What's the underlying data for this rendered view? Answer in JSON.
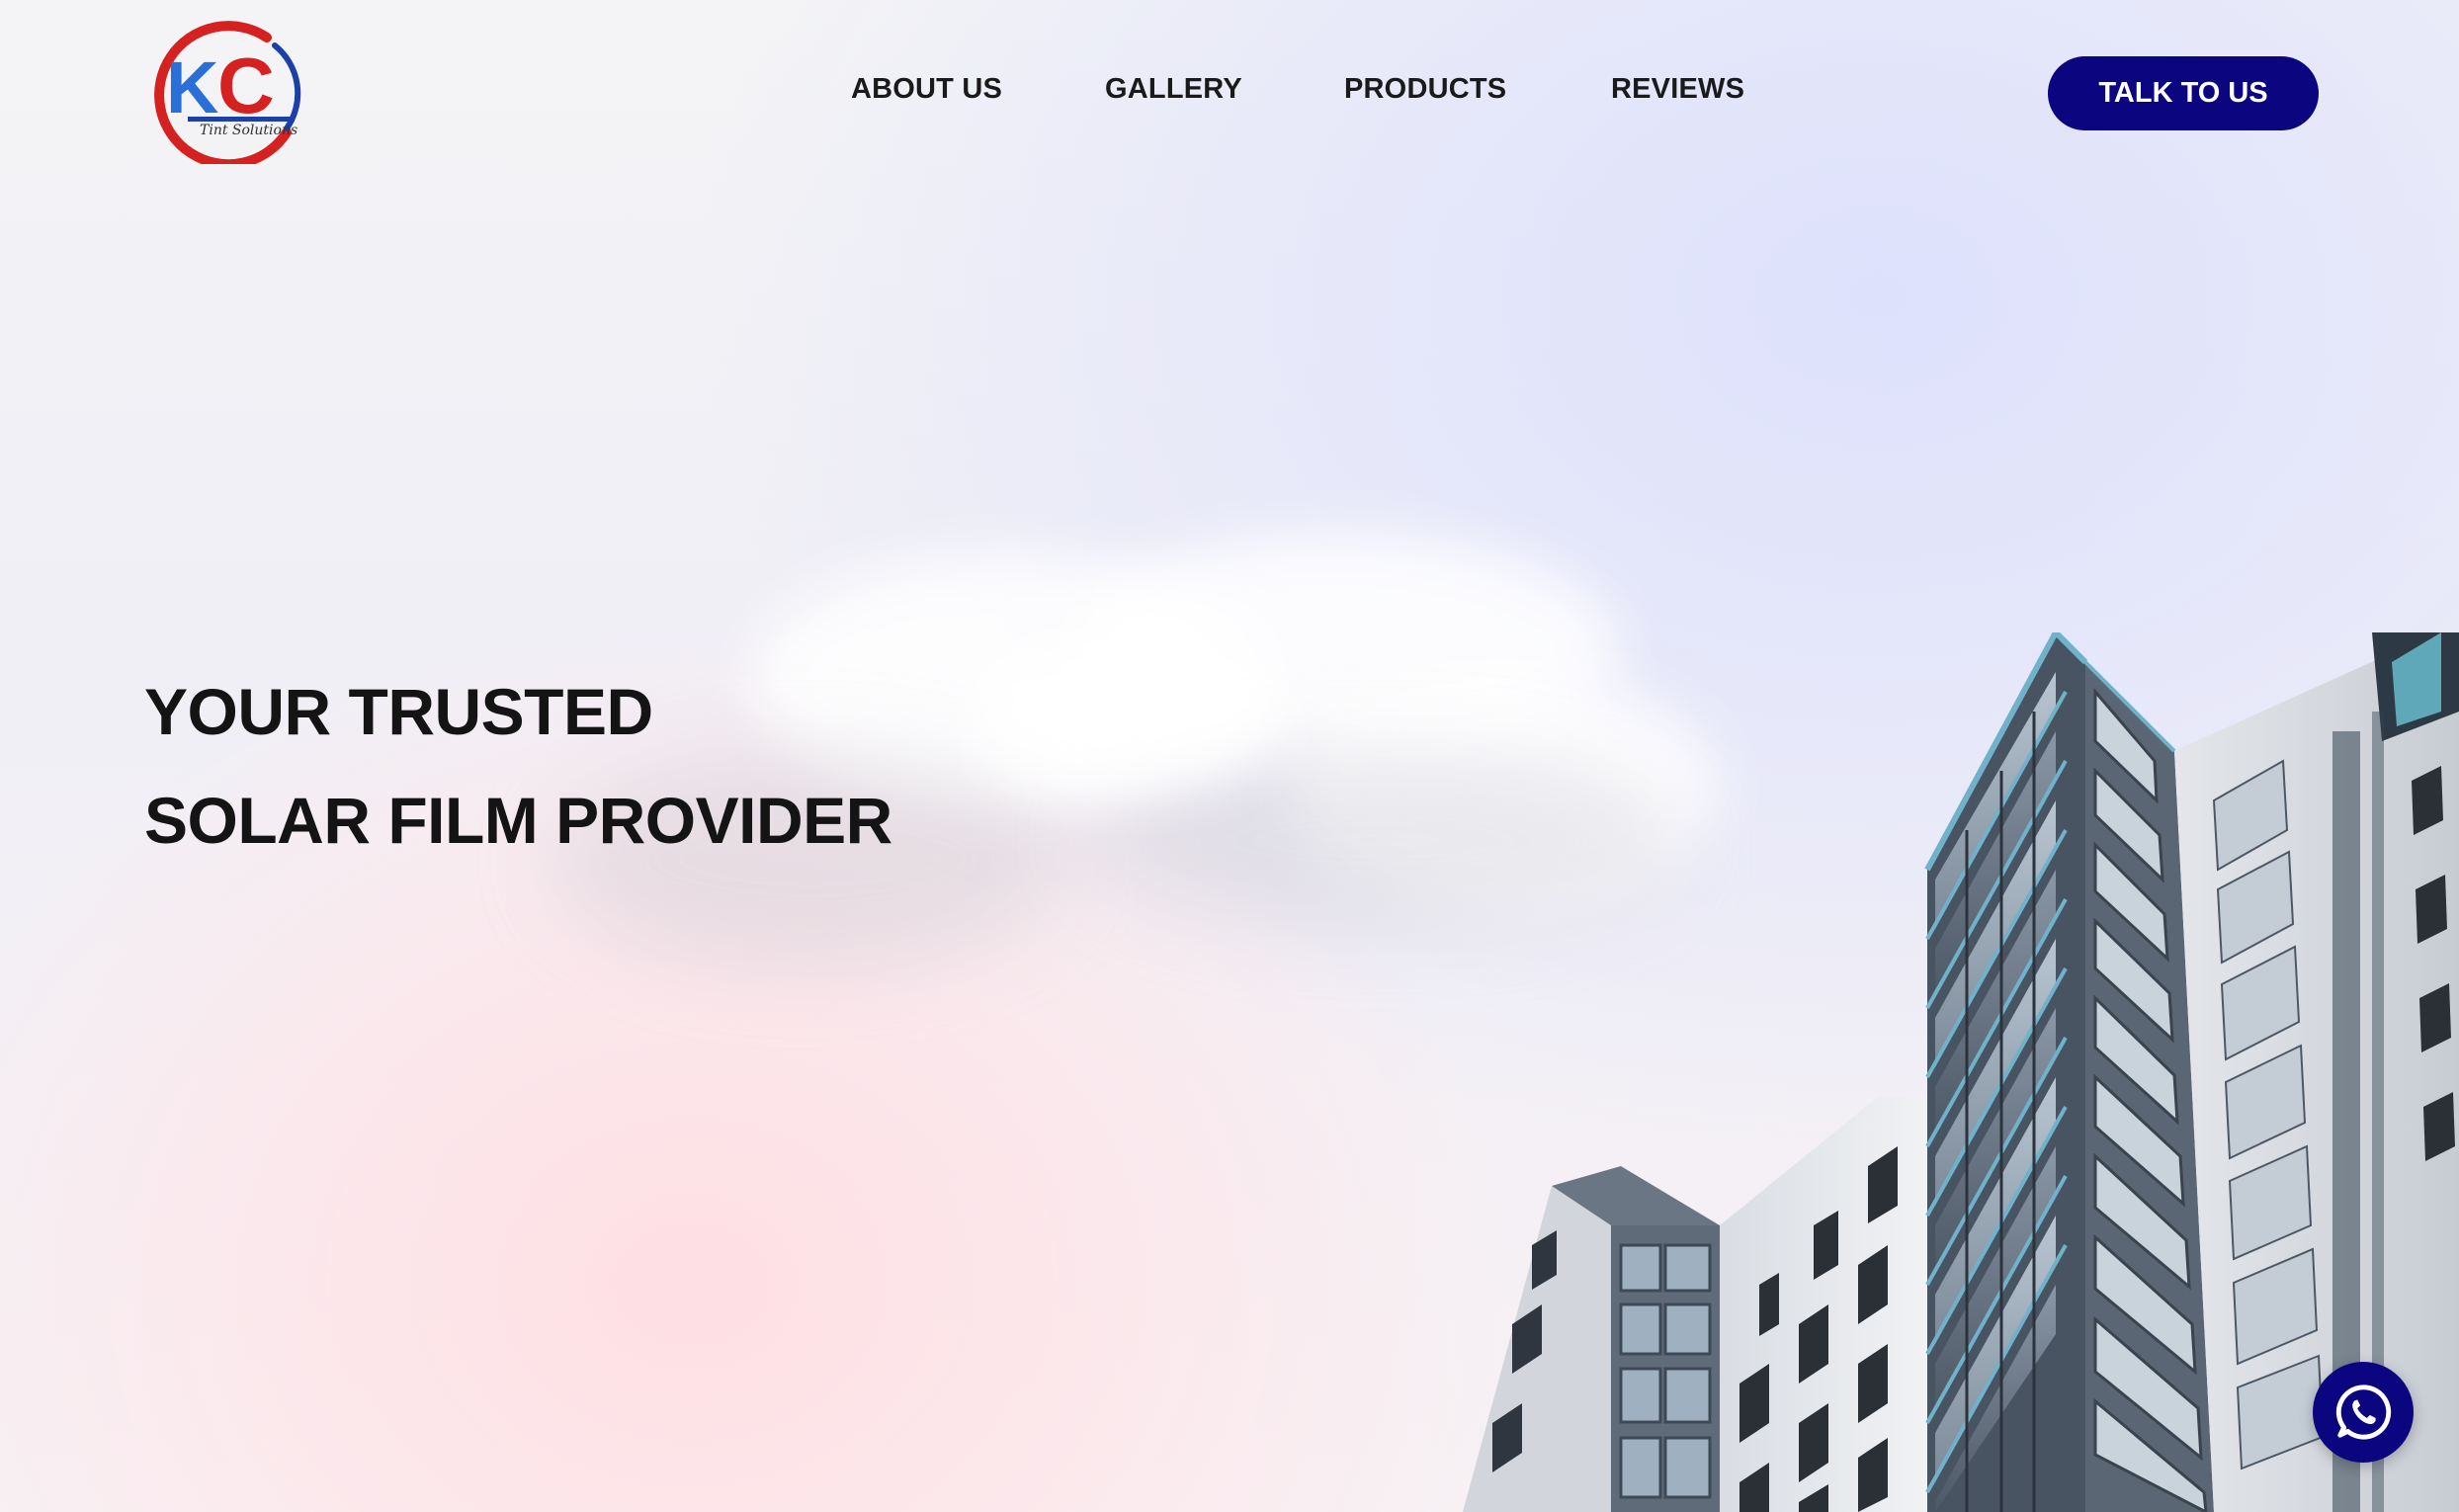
{
  "brand": {
    "logo_text": "KC",
    "logo_tagline": "Tint Solutions",
    "colors": {
      "red": "#d62121",
      "blue": "#2a6fd8",
      "navy": "#0b0680"
    }
  },
  "nav": {
    "items": [
      {
        "label": "ABOUT US"
      },
      {
        "label": "GALLERY"
      },
      {
        "label": "PRODUCTS"
      },
      {
        "label": "REVIEWS"
      }
    ],
    "cta_label": "TALK TO US"
  },
  "hero": {
    "headline_line1": "YOUR TRUSTED",
    "headline_line2": "SOLAR FILM PROVIDER",
    "image_subject": "modern glass apartment building against sky"
  },
  "floating": {
    "whatsapp_icon": "whatsapp-icon"
  }
}
